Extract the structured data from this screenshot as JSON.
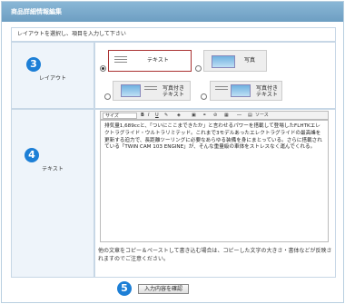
{
  "header": {
    "title": "商品詳細情報編集"
  },
  "instruction": "レイアウトを選択し、項目を入力して下さい",
  "layout_row": {
    "step": "3",
    "label": "レイアウト",
    "options": [
      {
        "label": "テキスト",
        "selected": true
      },
      {
        "label": "写真",
        "selected": false
      },
      {
        "label_line1": "写真付き",
        "label_line2": "テキスト",
        "selected": false
      },
      {
        "label_line1": "写真付き",
        "label_line2": "テキスト",
        "selected": false
      }
    ]
  },
  "text_row": {
    "step": "4",
    "label": "テキスト",
    "toolbar": {
      "size_label": "サイズ",
      "bold": "B",
      "italic": "I",
      "underline": "U",
      "source_label": "ソース"
    },
    "editor_content": "排気量1,689ccと、「ついにここまできたか」と言わせるパワーを搭載して登場したFLHTKエレクトラグライド・ウルトラリミテッド。これまで3モデルあったエレクトラグライドの最高峰を更新する迫力で、長距離ツーリングに必要なあらゆる装備を身にまとっている。さらに搭載されている「TWIN CAM 103 ENGINE」が、そんな重量級の車体をストレスなく運んでくれる。",
    "note": "他の文章をコピー＆ペーストして書き込む場合は、コピーした文字の大きさ・書体などが反映されますのでご注意ください。"
  },
  "confirm": {
    "step": "5",
    "button_label": "入力内容を確認"
  },
  "colors": {
    "header_bg": "#7aa9cc",
    "step_circle": "#1d7fd6",
    "selected_border": "#aa3333"
  }
}
